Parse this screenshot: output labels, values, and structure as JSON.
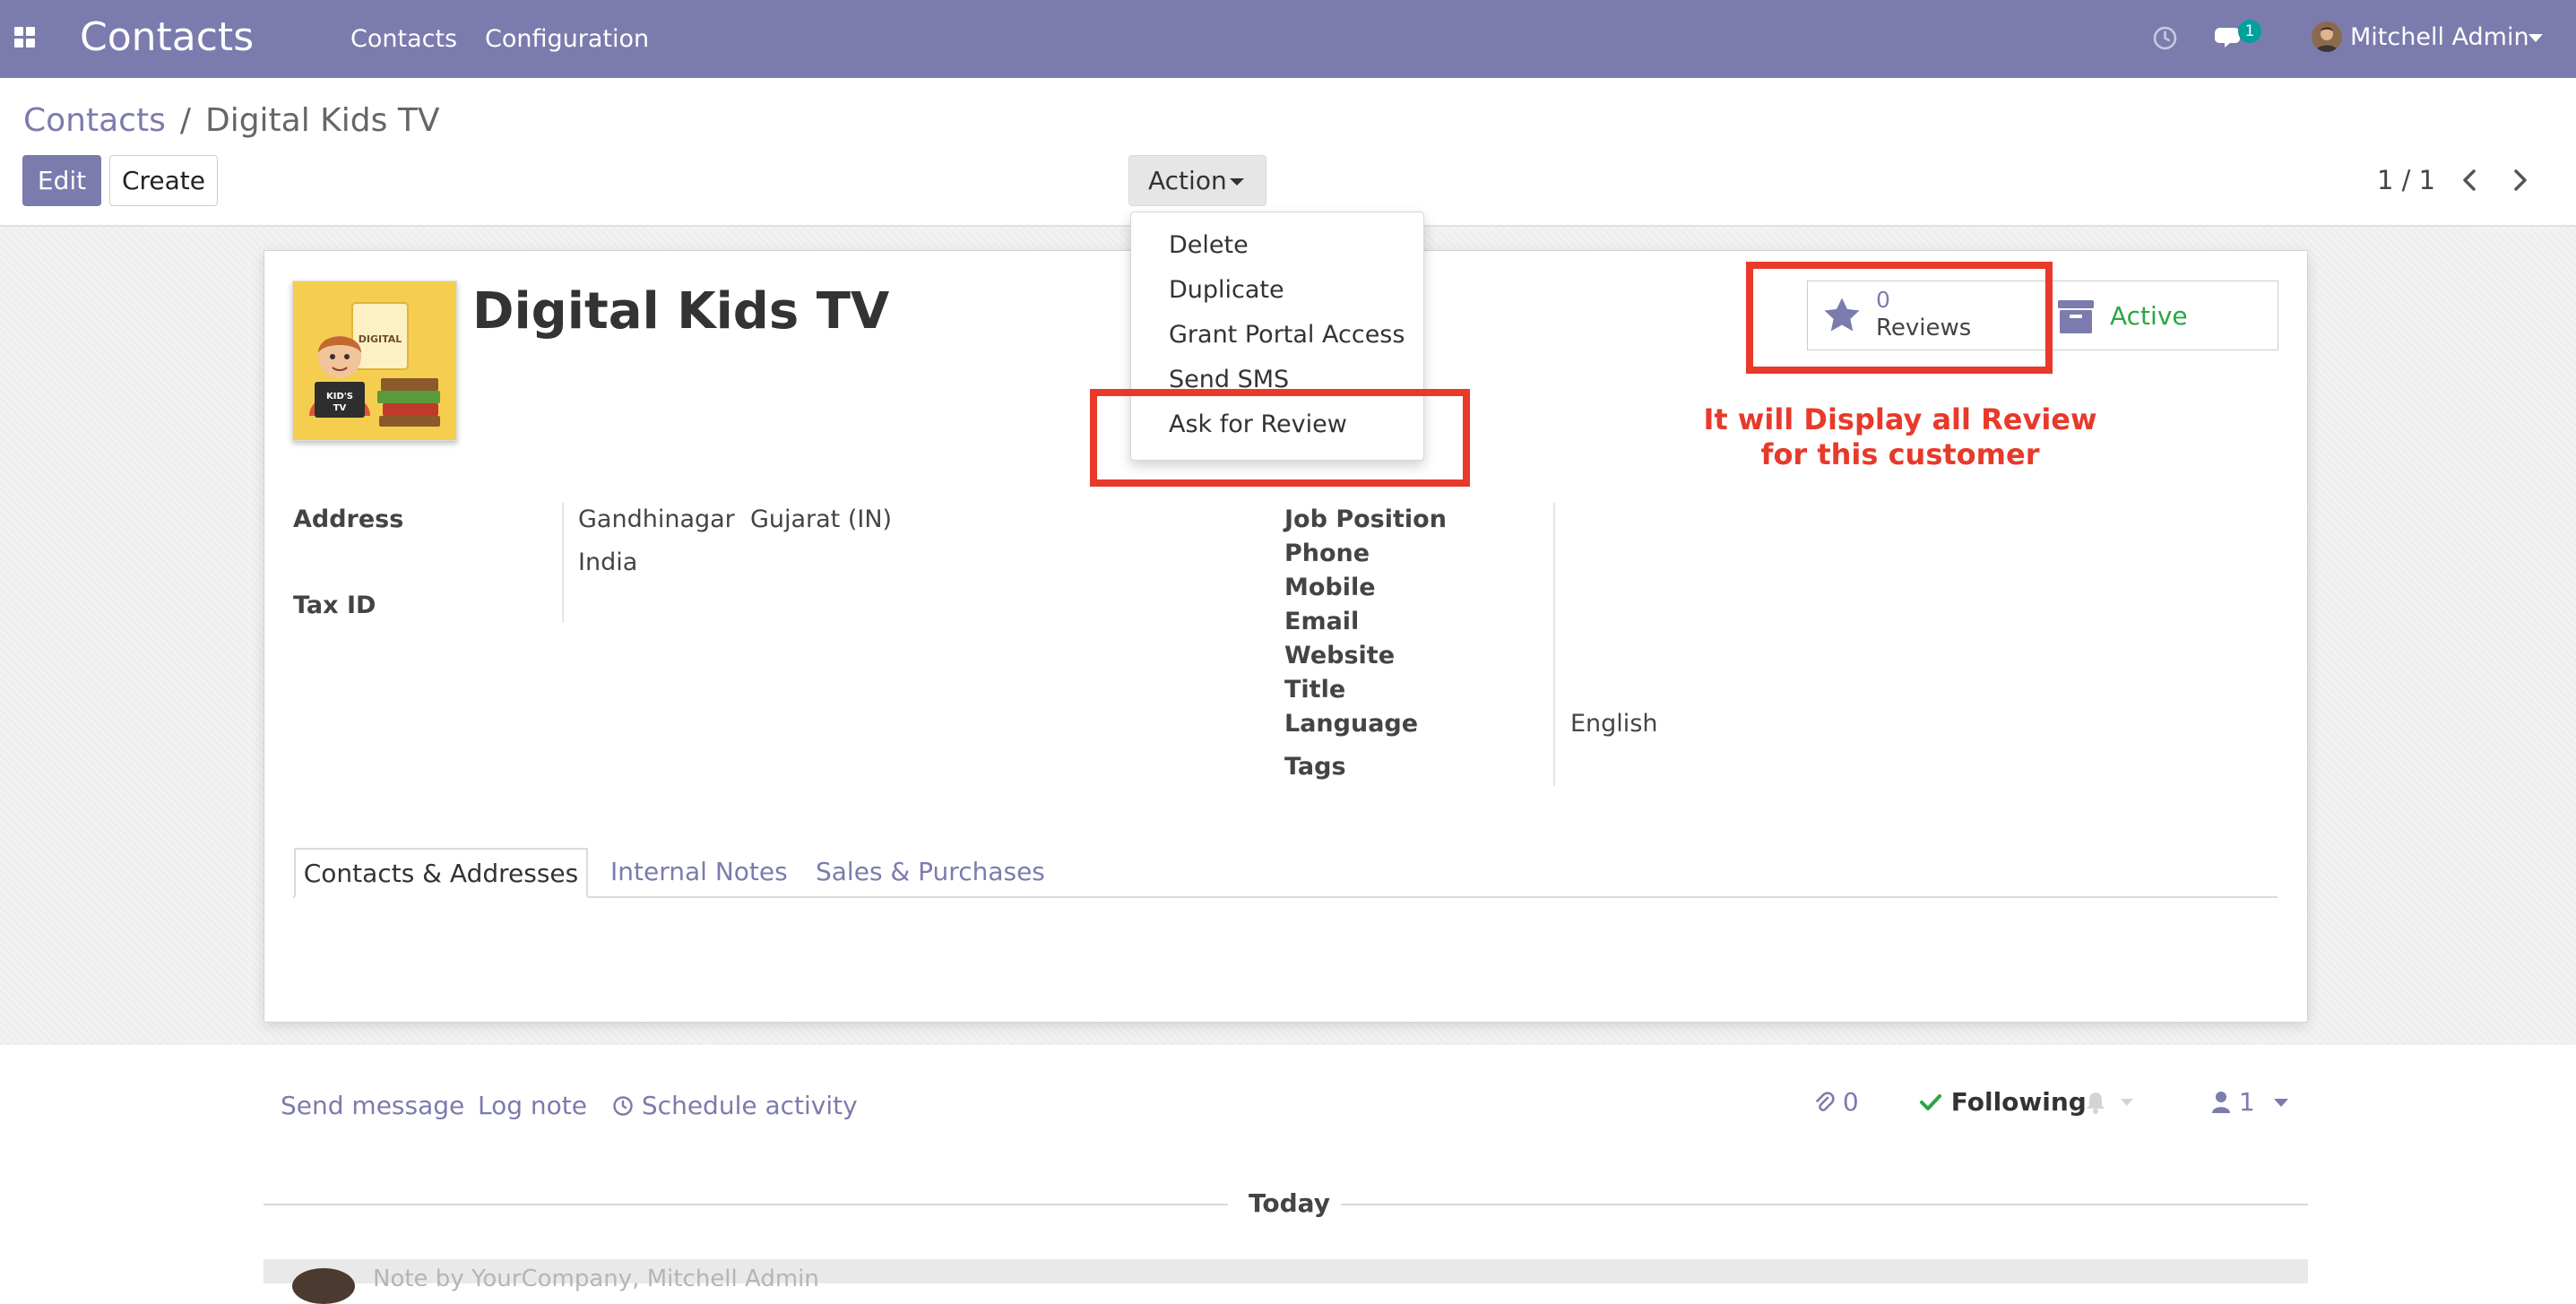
{
  "navbar": {
    "brand": "Contacts",
    "menu": [
      "Contacts",
      "Configuration"
    ],
    "messages_count": "1",
    "user_name": "Mitchell Admin"
  },
  "control_panel": {
    "breadcrumb": {
      "parent": "Contacts",
      "separator": "/",
      "current": "Digital Kids TV"
    },
    "edit_label": "Edit",
    "create_label": "Create",
    "action_label": "Action",
    "pager": "1 / 1"
  },
  "action_menu": {
    "items": [
      "Delete",
      "Duplicate",
      "Grant Portal Access",
      "Send SMS",
      "Ask for Review"
    ]
  },
  "record": {
    "name": "Digital Kids TV",
    "image_text": {
      "line1": "KID'S",
      "line2": "TV",
      "banner": "DIGITAL"
    },
    "stat_buttons": {
      "reviews_value": "0",
      "reviews_label": "Reviews",
      "active_label": "Active"
    },
    "left_fields": {
      "address_label": "Address",
      "address_line1": "Gandhinagar  Gujarat (IN)",
      "address_line2": "India",
      "tax_id_label": "Tax ID"
    },
    "right_fields": {
      "job_position": "Job Position",
      "phone": "Phone",
      "mobile": "Mobile",
      "email": "Email",
      "website": "Website",
      "title": "Title",
      "language": "Language",
      "language_value": "English",
      "tags": "Tags"
    },
    "tabs": [
      "Contacts & Addresses",
      "Internal Notes",
      "Sales & Purchases"
    ]
  },
  "chatter": {
    "send_message": "Send message",
    "log_note": "Log note",
    "schedule_activity": "Schedule activity",
    "attachments_count": "0",
    "following_label": "Following",
    "followers_count": "1",
    "day_separator": "Today",
    "message_author_partial": "Note by YourCompany, Mitchell Admin"
  },
  "annotation": {
    "line1": "It will Display all Review",
    "line2": "for this customer"
  },
  "colors": {
    "brand": "#7c7bad",
    "highlight": "#e8392a",
    "active": "#28a745"
  }
}
